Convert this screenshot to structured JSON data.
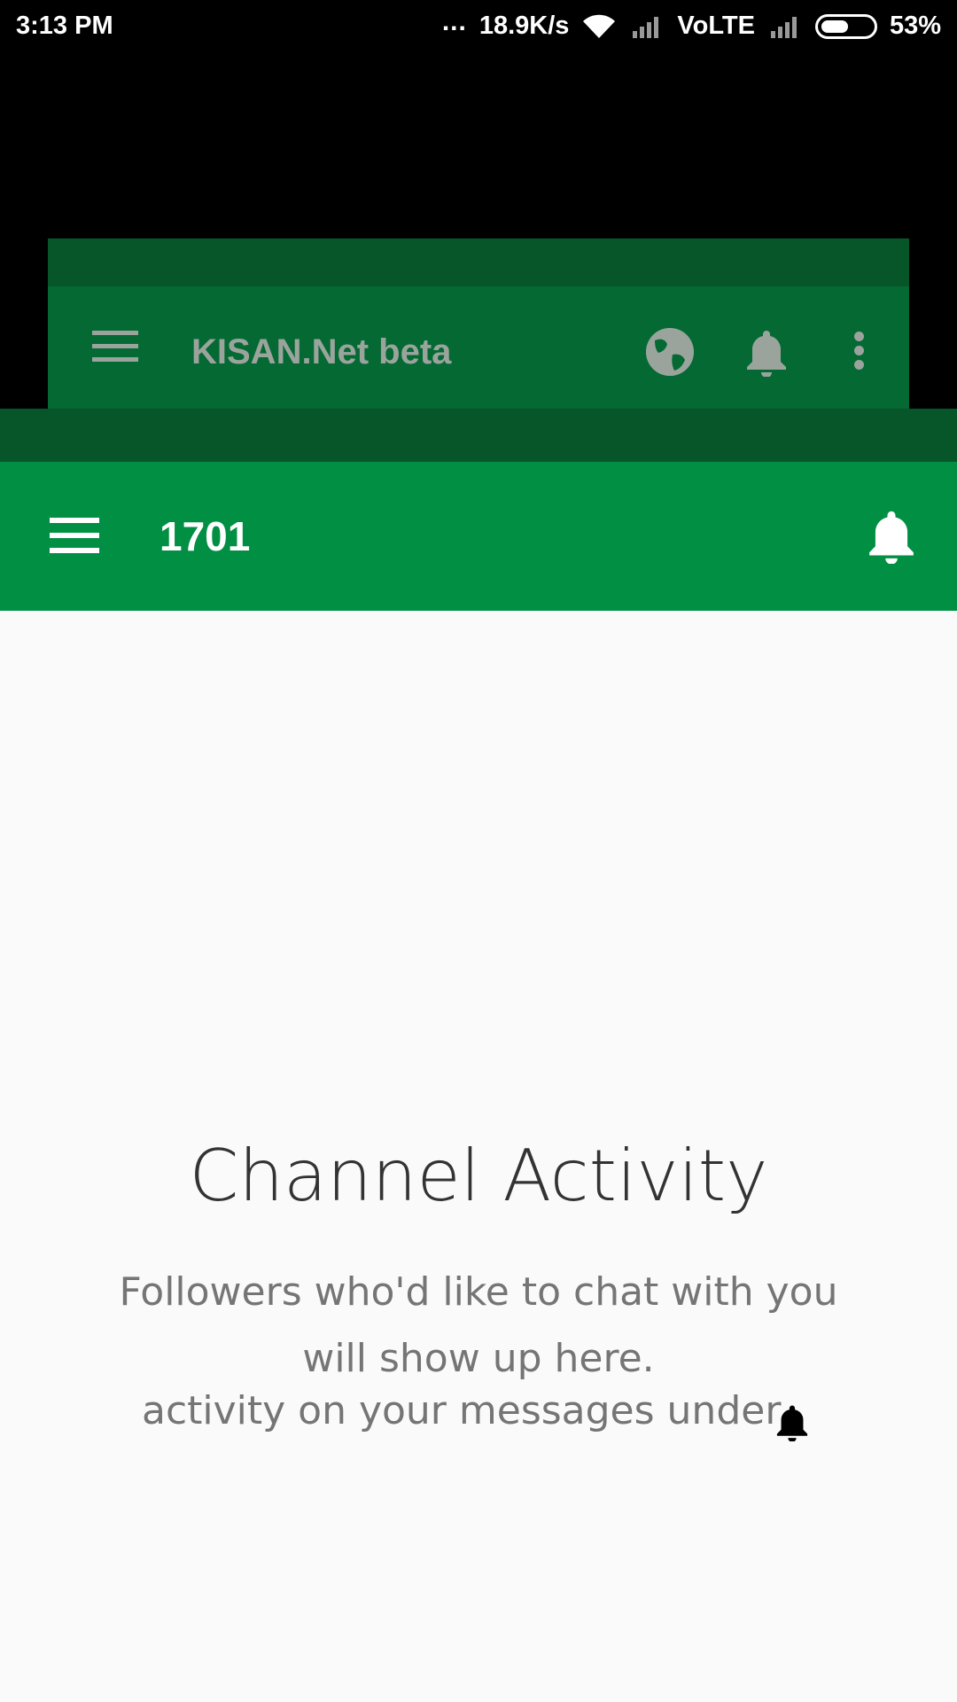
{
  "status_bar": {
    "time": "3:13 PM",
    "dots": "...",
    "speed": "18.9K/s",
    "network": "VoLTE",
    "battery": "53%",
    "battery_level": 0.53
  },
  "background_app": {
    "title": "KISAN.Net beta"
  },
  "app_bar": {
    "title": "1701"
  },
  "empty_state": {
    "title": "Channel Activity",
    "line1": "Followers who'd like to chat with you",
    "line2": "will show up here.",
    "line3": "activity on your messages under"
  },
  "colors": {
    "primary": "#018f43",
    "primary_dark": "#06562a",
    "background": "#fafafa"
  }
}
